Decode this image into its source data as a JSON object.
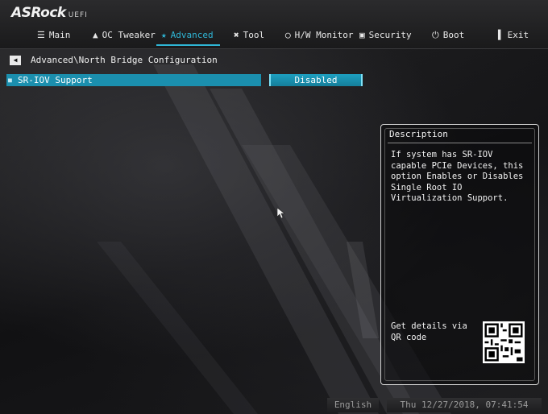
{
  "brand": {
    "name": "ASRock",
    "suffix": "UEFI"
  },
  "tabs": [
    {
      "label": "Main",
      "icon": "list-icon",
      "active": false
    },
    {
      "label": "OC Tweaker",
      "icon": "flame-icon",
      "active": false
    },
    {
      "label": "Advanced",
      "icon": "star-icon",
      "active": true
    },
    {
      "label": "Tool",
      "icon": "tools-icon",
      "active": false
    },
    {
      "label": "H/W Monitor",
      "icon": "monitor-icon",
      "active": false
    },
    {
      "label": "Security",
      "icon": "shield-icon",
      "active": false
    },
    {
      "label": "Boot",
      "icon": "power-icon",
      "active": false
    },
    {
      "label": "Exit",
      "icon": "exit-icon",
      "active": false
    }
  ],
  "breadcrumb": "Advanced\\North Bridge Configuration",
  "settings": [
    {
      "label": "SR-IOV Support",
      "value": "Disabled",
      "selected": true
    }
  ],
  "description": {
    "title": "Description",
    "text": "If system has SR-IOV capable PCIe Devices, this option Enables or Disables Single Root IO Virtualization Support.",
    "qr_label": "Get details via QR code"
  },
  "footer": {
    "language": "English",
    "datetime": "Thu 12/27/2018, 07:41:54"
  },
  "colors": {
    "accent": "#2fb6d6",
    "selection": "#1b8fae",
    "background": "#0c0c0d"
  }
}
